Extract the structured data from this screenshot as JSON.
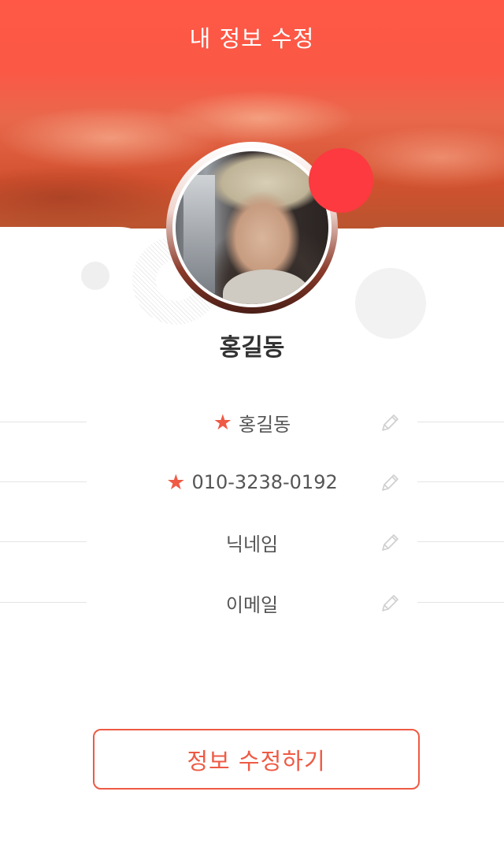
{
  "header": {
    "title": "내 정보 수정"
  },
  "profile": {
    "name": "홍길동"
  },
  "fields": [
    {
      "label": "홍길동",
      "required": true
    },
    {
      "label": "010-3238-0192",
      "required": true
    },
    {
      "label": "닉네임",
      "required": false
    },
    {
      "label": "이메일",
      "required": false
    }
  ],
  "submit": {
    "label": "정보 수정하기"
  },
  "colors": {
    "accent": "#ee5a44",
    "header": "#fb5846",
    "badge": "#fc3a3f"
  },
  "icons": {
    "required": "star-icon",
    "edit": "pencil-icon"
  }
}
